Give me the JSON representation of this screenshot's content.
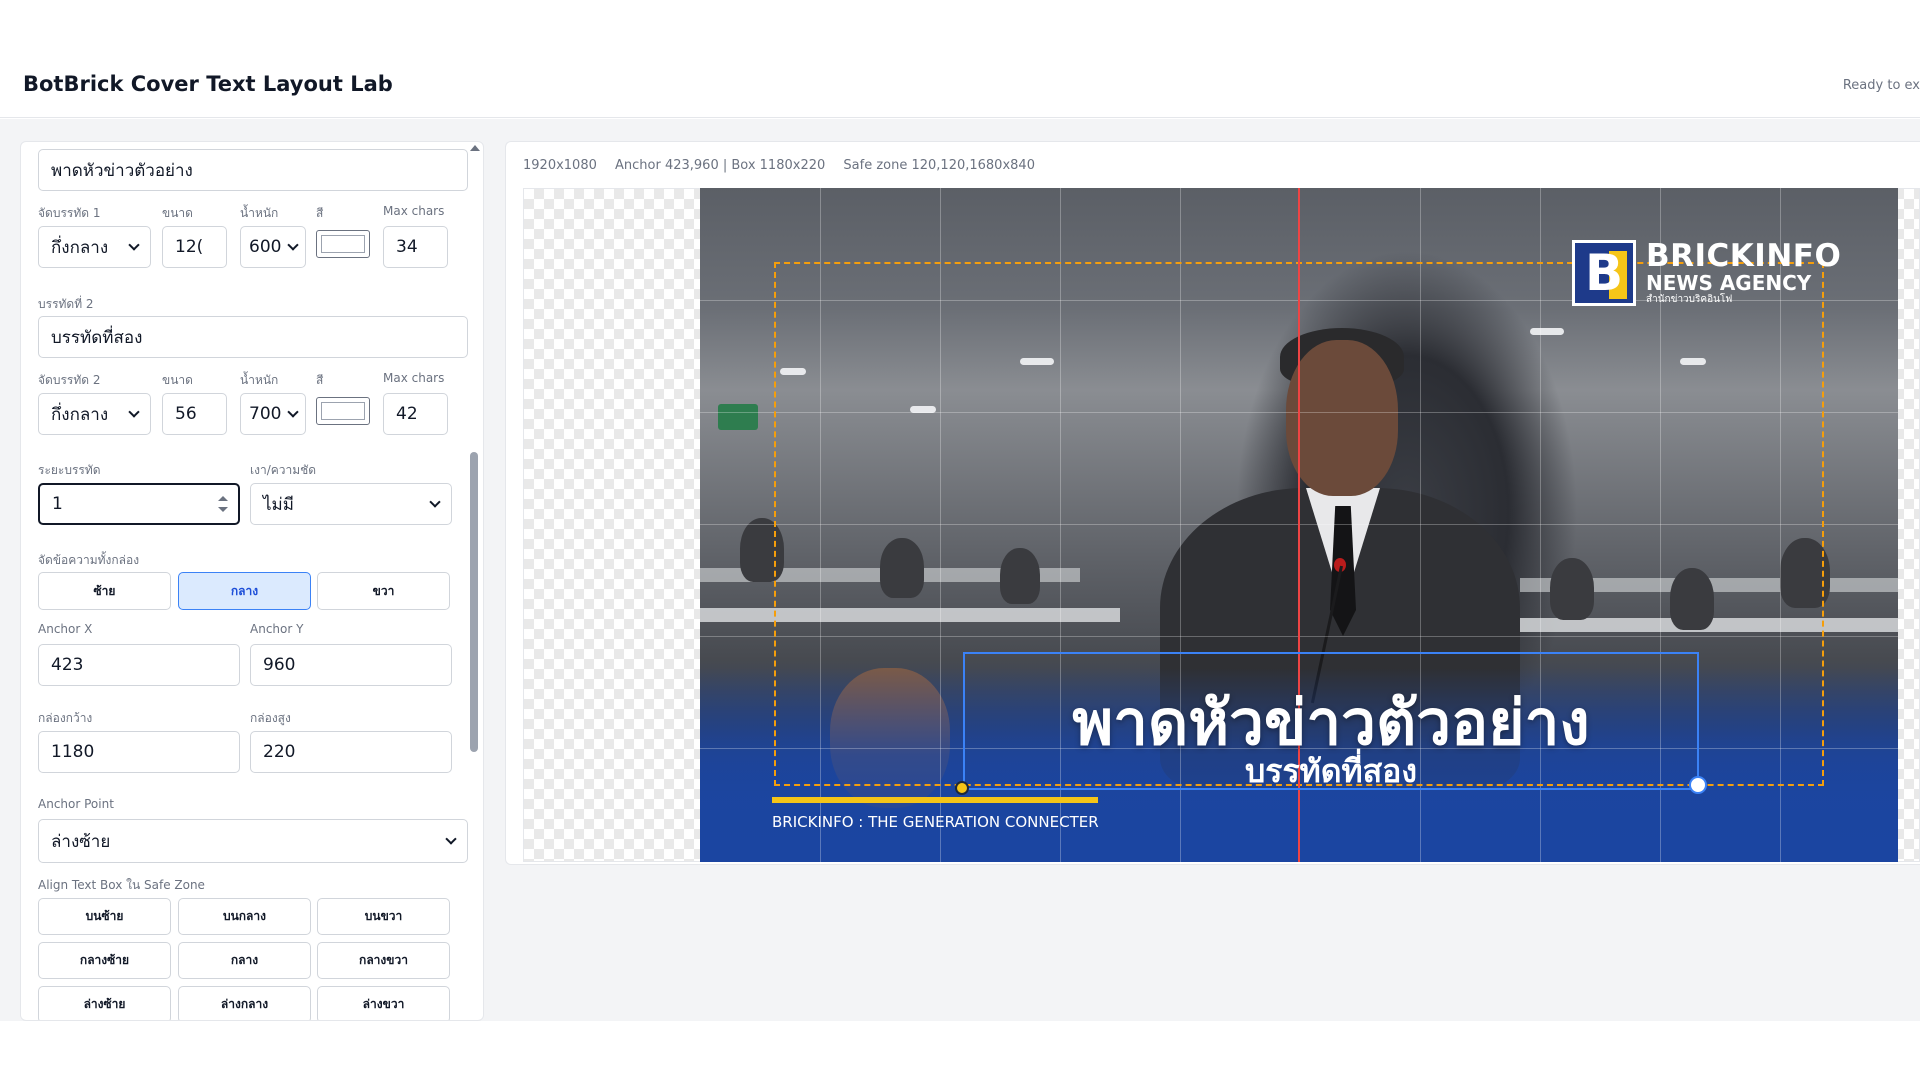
{
  "app": {
    "title": "BotBrick Cover Text Layout Lab",
    "status": "Ready to ex"
  },
  "panel": {
    "line1": {
      "text": "พาดหัวข่าวตัวอย่าง",
      "align_label": "จัดบรรทัด 1",
      "align_value": "กึ่งกลาง",
      "size_label": "ขนาด",
      "size_value": "12(",
      "weight_label": "น้ำหนัก",
      "weight_value": "600",
      "color_label": "สี",
      "maxchars_label": "Max chars",
      "maxchars_value": "34"
    },
    "line2": {
      "section_label": "บรรทัดที่ 2",
      "text": "บรรทัดที่สอง",
      "align_label": "จัดบรรทัด 2",
      "align_value": "กึ่งกลาง",
      "size_label": "ขนาด",
      "size_value": "56",
      "weight_label": "น้ำหนัก",
      "weight_value": "700",
      "color_label": "สี",
      "maxchars_label": "Max chars",
      "maxchars_value": "42"
    },
    "line_spacing_label": "ระยะบรรทัด",
    "line_spacing_value": "1",
    "shadow_label": "เงา/ความชัด",
    "shadow_value": "ไม่มี",
    "box_align_label": "จัดข้อความทั้งกล่อง",
    "box_align_buttons": [
      "ซ้าย",
      "กลาง",
      "ขวา"
    ],
    "anchor_x_label": "Anchor X",
    "anchor_x_value": "423",
    "anchor_y_label": "Anchor Y",
    "anchor_y_value": "960",
    "box_width_label": "กล่องกว้าง",
    "box_width_value": "1180",
    "box_height_label": "กล่องสูง",
    "box_height_value": "220",
    "anchor_point_label": "Anchor Point",
    "anchor_point_value": "ล่างซ้าย",
    "safezone_align_label": "Align Text Box ใน Safe Zone",
    "safezone_buttons": [
      "บนซ้าย",
      "บนกลาง",
      "บนขวา",
      "กลางซ้าย",
      "กลาง",
      "กลางขวา",
      "ล่างซ้าย",
      "ล่างกลาง",
      "ล่างขวา"
    ]
  },
  "stage": {
    "meta": {
      "size": "1920x1080",
      "anchor_box": "Anchor 423,960 | Box 1180x220",
      "safe_zone": "Safe zone 120,120,1680x840"
    },
    "logo": {
      "mark": "B",
      "line1": "BRICKINFO",
      "line2": "NEWS AGENCY",
      "line3": "สำนักข่าวบริคอินโฟ"
    },
    "headline": "พาดหัวข่าวตัวอย่าง",
    "subline": "บรรทัดที่สอง",
    "tagline": "BRICKINFO : THE GENERATION CONNECTER"
  },
  "colors": {
    "accent": "#3b82f6",
    "guide_red": "#ef4444",
    "safe_zone": "#f59e0b",
    "brand_blue": "#1b45a1",
    "brand_yellow": "#f5c518"
  }
}
